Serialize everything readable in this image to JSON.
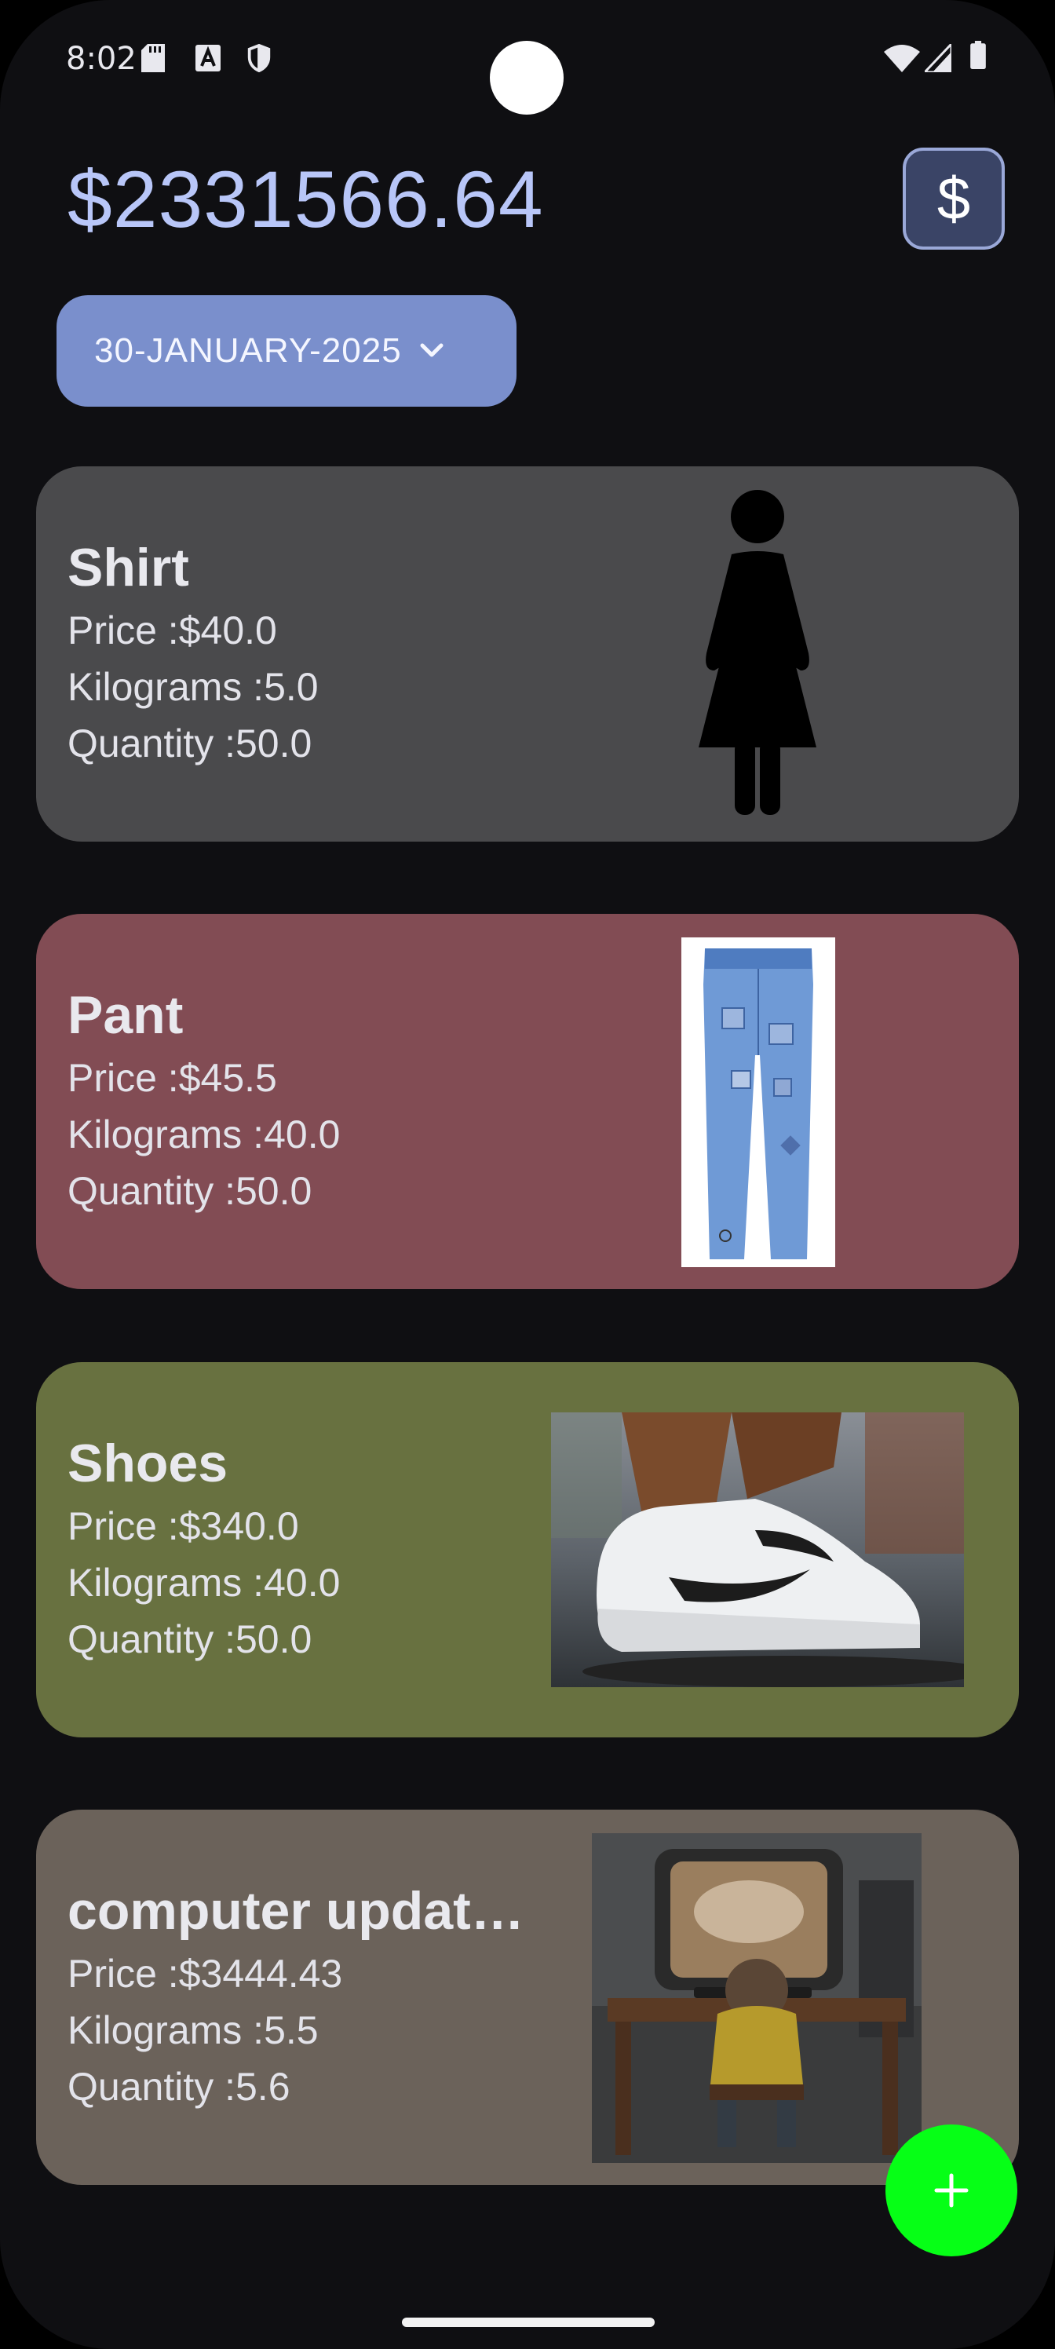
{
  "status_bar": {
    "time": "8:02",
    "icons": [
      "sd-card-icon",
      "a-badge-icon",
      "shield-icon",
      "wifi-icon",
      "signal-icon",
      "battery-icon"
    ]
  },
  "header": {
    "balance": "$2331566.64",
    "currency_button_label": "$"
  },
  "date_selector": {
    "label": "30-JANUARY-2025",
    "icon": "chevron-down-icon"
  },
  "items": [
    {
      "name": "Shirt",
      "price": "Price :$40.0",
      "kilograms": "Kilograms :5.0",
      "quantity": "Quantity :50.0",
      "color": "#4a4a4c",
      "image": "person-silhouette-image"
    },
    {
      "name": "Pant",
      "price": "Price :$45.5",
      "kilograms": "Kilograms :40.0",
      "quantity": "Quantity :50.0",
      "color": "#824c54",
      "image": "jeans-image"
    },
    {
      "name": "Shoes",
      "price": "Price :$340.0",
      "kilograms": "Kilograms :40.0",
      "quantity": "Quantity :50.0",
      "color": "#687140",
      "image": "sneaker-photo-image"
    },
    {
      "name": "computer updat…",
      "price": "Price :$3444.43",
      "kilograms": "Kilograms :5.5",
      "quantity": "Quantity :5.6",
      "color": "#6b625a",
      "image": "child-at-computer-image"
    }
  ],
  "fab": {
    "icon": "plus-icon",
    "color": "#06ff16"
  }
}
